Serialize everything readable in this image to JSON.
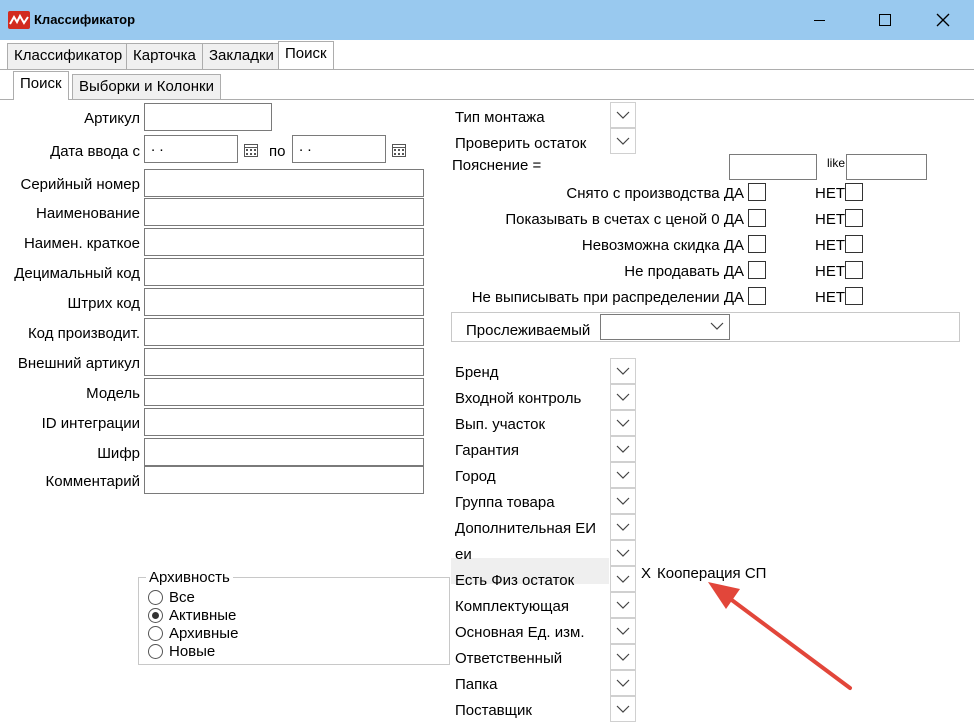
{
  "window": {
    "title": "Классификатор",
    "controls": {
      "minimize": "minimize-icon",
      "maximize": "maximize-icon",
      "close": "close-icon"
    }
  },
  "tabs": [
    "Классификатор",
    "Карточка",
    "Закладки",
    "Поиск"
  ],
  "subtabs": [
    "Поиск",
    "Выборки и Колонки"
  ],
  "left": {
    "article_label": "Артикул",
    "date_label": "Дата ввода с",
    "date_from": " .  .",
    "date_to_label": "по",
    "date_to": " .  .",
    "fields": [
      "Серийный номер",
      "Наименование",
      "Наимен. краткое",
      "Децимальный код",
      "Штрих код",
      "Код производит.",
      "Внешний артикул",
      "Модель",
      "ID интеграции",
      "Шифр",
      "Комментарий"
    ]
  },
  "archive": {
    "title": "Архивность",
    "options": [
      "Все",
      "Активные",
      "Архивные",
      "Новые"
    ],
    "selected": "Активные"
  },
  "right": {
    "mount_type": "Тип монтажа",
    "check_stock": "Проверить остаток",
    "explanation_label": "Пояснение =",
    "like_label": "like",
    "yes_label": "ДА",
    "no_label": "НЕТ",
    "checks": [
      "Снято с производства",
      "Показывать в счетах с ценой 0",
      "Невозможна скидка",
      "Не продавать",
      "Не выписывать при распределении"
    ],
    "tracked_label": "Прослеживаемый",
    "attrs": [
      "Бренд",
      "Входной контроль",
      "Вып. участок",
      "Гарантия",
      "Город",
      "Группа товара",
      "Дополнительная ЕИ",
      "еи",
      "Есть Физ остаток",
      "Комплектующая",
      "Основная Ед. изм.",
      "Ответственный",
      "Папка",
      "Поставщик"
    ],
    "physical_stock_clear": "X",
    "physical_stock_value": "Кооперация СП"
  },
  "colors": {
    "titlebar": "#99c9ef",
    "arrow": "#e2463a",
    "logo": "#d22b1f"
  }
}
